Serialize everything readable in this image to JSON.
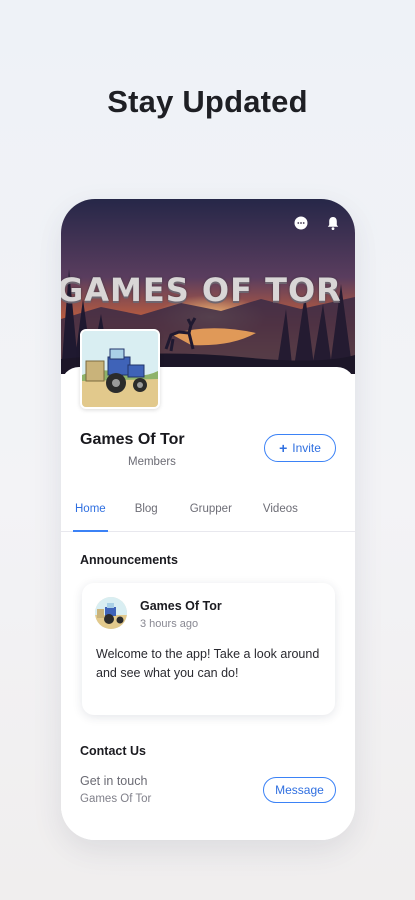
{
  "headline": "Stay Updated",
  "hero": {
    "banner_text": "GAMES OF TOR",
    "icons": [
      "chat-icon",
      "bell-icon"
    ]
  },
  "group": {
    "name": "Games Of Tor",
    "members_label": "Members",
    "invite_label": "Invite"
  },
  "tabs": [
    {
      "label": "Home",
      "active": true
    },
    {
      "label": "Blog",
      "active": false
    },
    {
      "label": "Grupper",
      "active": false
    },
    {
      "label": "Videos",
      "active": false
    }
  ],
  "announcements": {
    "title": "Announcements",
    "post": {
      "author": "Games Of Tor",
      "time": "3 hours ago",
      "text": "Welcome to the app! Take a look around and see what you can do!"
    }
  },
  "contact": {
    "title": "Contact Us",
    "subtitle": "Get in touch",
    "name": "Games Of Tor",
    "message_label": "Message"
  },
  "colors": {
    "accent": "#3b82f6",
    "banner_sky_top": "#2b2d55",
    "banner_sunset": "#e07a3a"
  }
}
